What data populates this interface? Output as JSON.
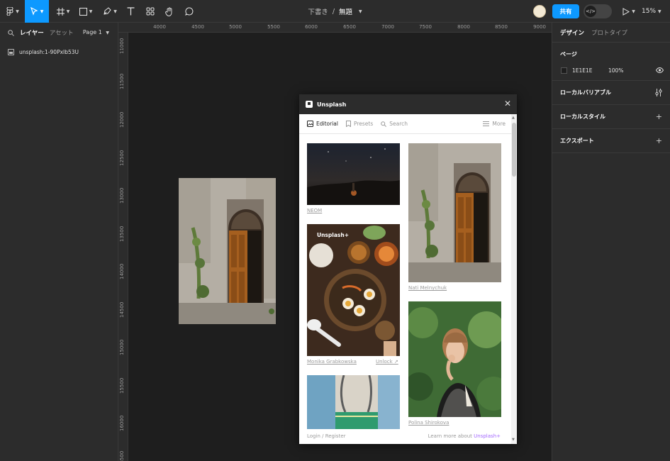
{
  "toolbar": {
    "tools": [
      "figma-menu",
      "move",
      "frame",
      "shape",
      "pen",
      "text",
      "resources",
      "hand",
      "comment"
    ],
    "draft_label": "下書き",
    "separator": "/",
    "file_name": "無題",
    "share_label": "共有",
    "zoom_label": "15%"
  },
  "left_panel": {
    "tabs": [
      "レイヤー",
      "アセット"
    ],
    "page_label": "Page 1",
    "layers": [
      {
        "name": "unsplash:1-90PxIb53U"
      }
    ]
  },
  "rulers": {
    "top": [
      "4000",
      "4500",
      "5000",
      "5500",
      "6000",
      "6500",
      "7000",
      "7500",
      "8000",
      "8500",
      "9000"
    ],
    "left": [
      "11000",
      "11500",
      "12000",
      "12500",
      "13000",
      "13500",
      "14000",
      "14500",
      "15000",
      "15500",
      "16000",
      "16500"
    ]
  },
  "right_panel": {
    "tabs": [
      "デザイン",
      "プロトタイプ"
    ],
    "page_section": {
      "title": "ページ",
      "color_hex": "1E1E1E",
      "opacity": "100%"
    },
    "sections": [
      "ローカルバリアブル",
      "ローカルスタイル",
      "エクスポート"
    ]
  },
  "plugin": {
    "title": "Unsplash",
    "nav": {
      "editorial": "Editorial",
      "presets": "Presets",
      "search": "Search",
      "more": "More"
    },
    "photos": {
      "neom_credit": "NEOM",
      "food_badge": "Unsplash+",
      "food_credit": "Monika Grabkowska",
      "food_unlock": "Unlock ↗",
      "door_credit": "Nati Melnychuk",
      "woman_credit": "Polina Shirokova"
    },
    "footer": {
      "login": "Login / Register",
      "learn_prefix": "Learn more about",
      "learn_brand": "Unsplash+"
    }
  },
  "colors": {
    "accent": "#0d99ff",
    "ui_bg": "#2c2c2c",
    "canvas_bg": "#1e1e1e",
    "unsplash_plus": "#a368ff"
  }
}
